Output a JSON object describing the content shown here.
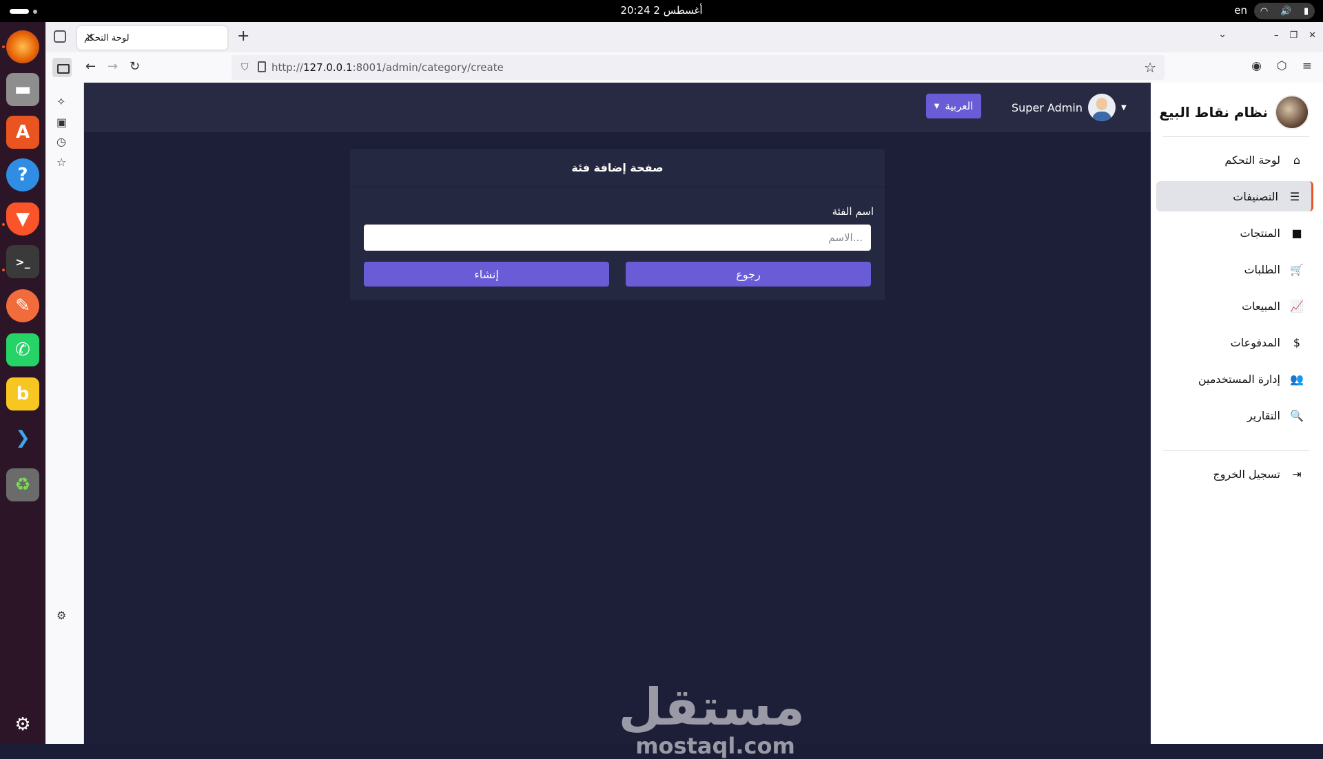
{
  "system": {
    "clock": "20:24  2 أغسطس",
    "lang": "en"
  },
  "browser": {
    "tab_title": "لوحة التحكم",
    "url_prefix": "http://",
    "url_host": "127.0.0.1",
    "url_rest": ":8001/admin/category/create"
  },
  "sidebar": {
    "brand": "نظام نقاط البيع",
    "items": [
      {
        "label": "لوحة التحكم",
        "icon": "home-icon",
        "glyph": "⌂"
      },
      {
        "label": "التصنيفات",
        "icon": "table-list-icon",
        "glyph": "☰"
      },
      {
        "label": "المنتجات",
        "icon": "box-icon",
        "glyph": "■"
      },
      {
        "label": "الطلبات",
        "icon": "cart-icon",
        "glyph": "🛒"
      },
      {
        "label": "المبيعات",
        "icon": "chart-line-icon",
        "glyph": "📈"
      },
      {
        "label": "المدفوعات",
        "icon": "dollar-icon",
        "glyph": "$"
      },
      {
        "label": "إدارة المستخدمين",
        "icon": "users-icon",
        "glyph": "👥"
      },
      {
        "label": "التقارير",
        "icon": "search-chart-icon",
        "glyph": "🔍"
      }
    ],
    "logout": {
      "label": "تسجيل الخروج",
      "icon": "logout-icon",
      "glyph": "⇥"
    }
  },
  "header": {
    "language_button": "العربية",
    "user_name": "Super Admin"
  },
  "form": {
    "title": "صفحة إضافة فئة",
    "field_label": "اسم الفئة",
    "field_placeholder": "...الاسم",
    "field_value": "",
    "create_button": "إنشاء",
    "back_button": "رجوع"
  },
  "watermark": {
    "arabic": "مستقل",
    "latin": "mostaql.com"
  },
  "colors": {
    "accent": "#6a5cd6",
    "background": "#1d1f38",
    "header": "#272a42",
    "card": "#252841",
    "active_marker": "#e95420"
  }
}
